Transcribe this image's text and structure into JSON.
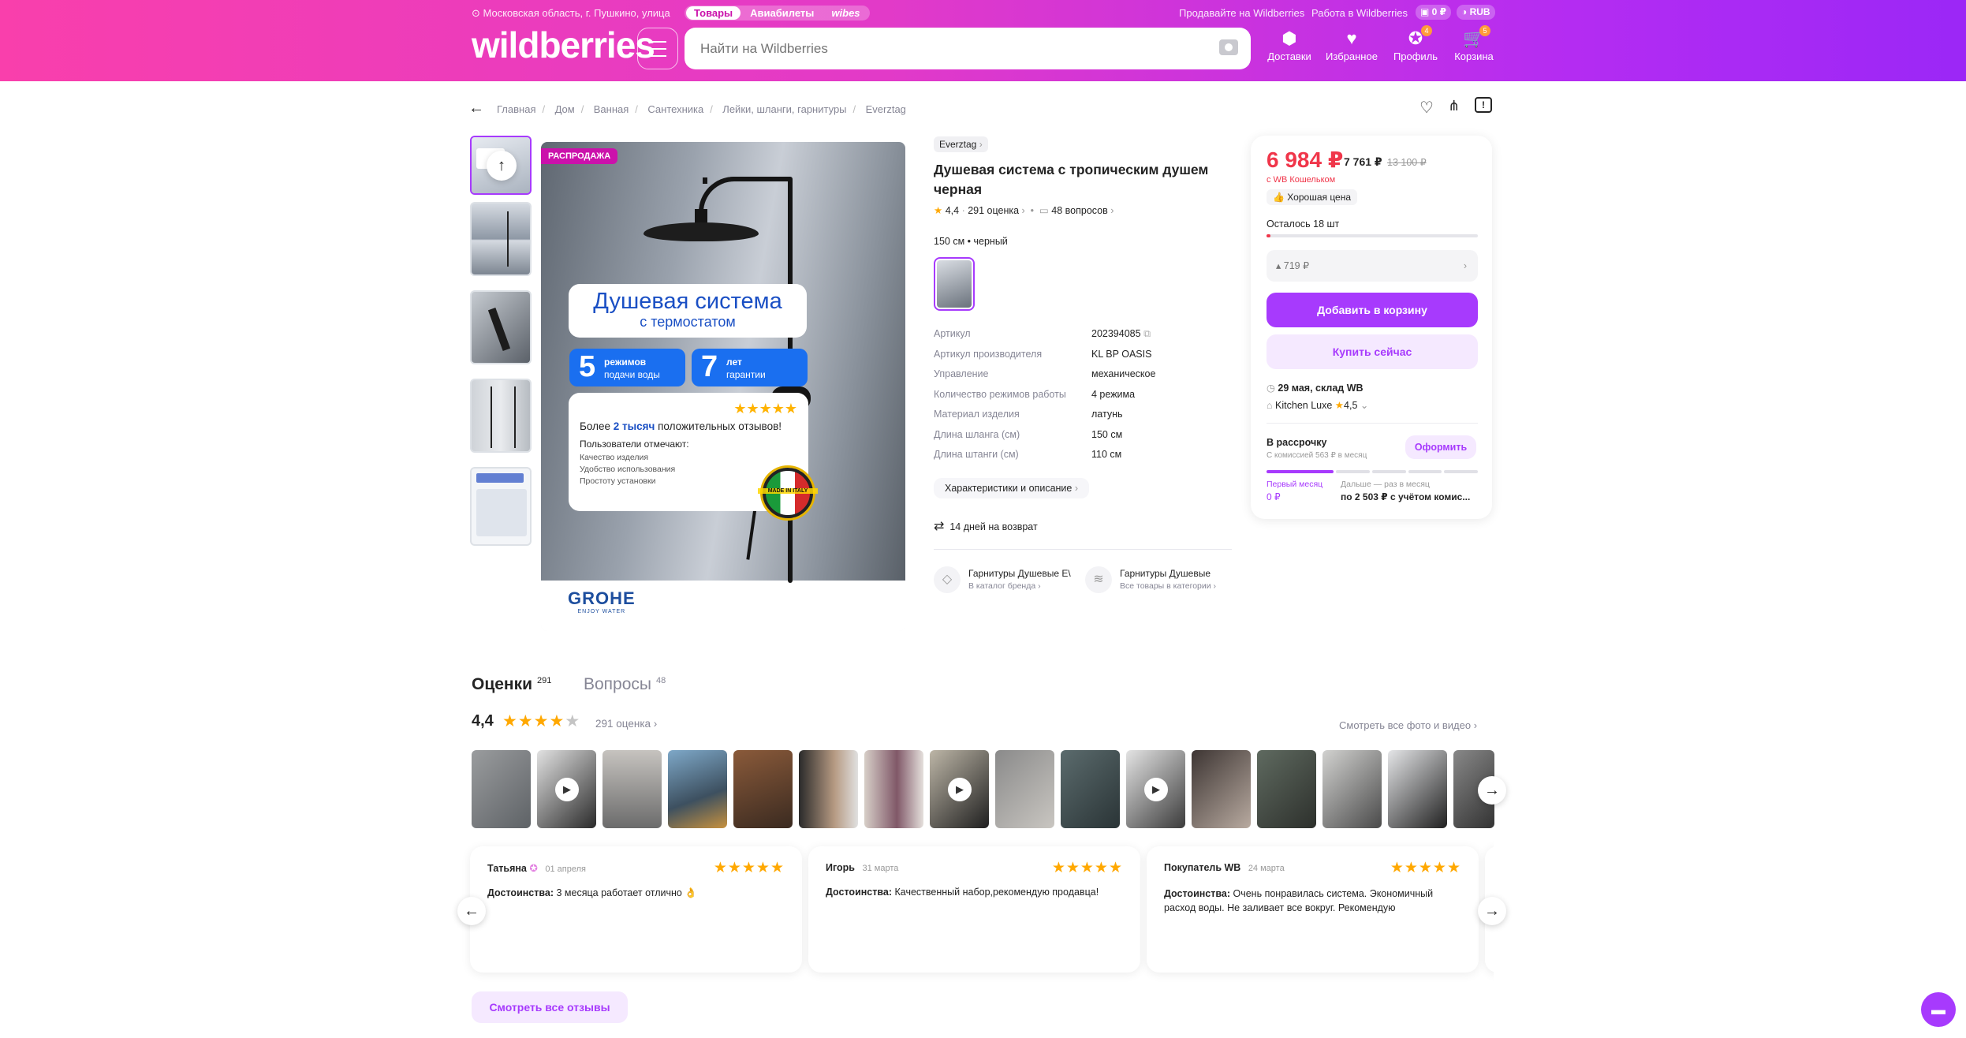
{
  "header": {
    "location": "Московская область, г. Пушкино, улица",
    "tabs": [
      "Товары",
      "Авиабилеты",
      "wibes"
    ],
    "links": [
      "Продавайте на Wildberries",
      "Работа в Wildberries"
    ],
    "balance": "0 ₽",
    "currency": "RUB",
    "logo": "wildberries",
    "search_placeholder": "Найти на Wildberries",
    "nav": [
      {
        "label": "Доставки",
        "icon": "box-icon",
        "badge": ""
      },
      {
        "label": "Избранное",
        "icon": "heart-icon",
        "badge": ""
      },
      {
        "label": "Профиль",
        "icon": "profile-icon",
        "badge": "4"
      },
      {
        "label": "Корзина",
        "icon": "cart-icon",
        "badge": "5"
      }
    ]
  },
  "breadcrumbs": [
    "Главная",
    "Дом",
    "Ванная",
    "Сантехника",
    "Лейки, шланги, гарнитуры",
    "Everztag"
  ],
  "product": {
    "brand": "Everztag",
    "title_line1": "Душевая система с тропическим душем",
    "title_line2": "черная",
    "rating": "4,4",
    "reviews_count": "291 оценка",
    "questions_count": "48 вопросов",
    "variant": "150 см • черный",
    "specs": [
      {
        "k": "Артикул",
        "v": "202394085"
      },
      {
        "k": "Артикул производителя",
        "v": "KL BP OASIS"
      },
      {
        "k": "Управление",
        "v": "механическое"
      },
      {
        "k": "Количество режимов работы",
        "v": "4 режима"
      },
      {
        "k": "Материал изделия",
        "v": "латунь"
      },
      {
        "k": "Длина шланга (см)",
        "v": "150 см"
      },
      {
        "k": "Длина штанги (см)",
        "v": "110 см"
      }
    ],
    "specs_button": "Характеристики и описание",
    "return_text": "14 дней на возврат",
    "brand_card": {
      "title": "Гарнитуры Душевые E\\",
      "sub": "В каталог бренда"
    },
    "category_card": {
      "title": "Гарнитуры Душевые",
      "sub": "Все товары в категории"
    }
  },
  "image": {
    "sale_badge": "РАСПРОДАЖА",
    "headline": "Душевая система",
    "subheadline": "с термостатом",
    "modes_num": "5",
    "modes_text1": "режимов",
    "modes_text2": "подачи воды",
    "warranty_num": "7",
    "warranty_text1": "лет",
    "warranty_text2": "гарантии",
    "review_pre": "Более",
    "review_bold": "2 тысяч",
    "review_post": "положительных отзывов!",
    "users_note": "Пользователи отмечают:",
    "bullets": [
      "Качество изделия",
      "Удобство использования",
      "Простоту установки"
    ],
    "seal": "MADE IN ITALY",
    "grohe": "GROHE",
    "grohe_sub": "ENJOY WATER"
  },
  "price": {
    "wallet_price": "6 984 ₽",
    "price": "7 761 ₽",
    "old_price": "13 100 ₽",
    "wallet_label": "с WB Кошельком",
    "good_price": "Хорошая цена",
    "stock": "Осталось 18 шт",
    "stock_fraction": 0.02,
    "installment_select": "719 ₽",
    "add_to_cart": "Добавить в корзину",
    "buy_now": "Купить сейчас",
    "delivery": "29 мая, склад WB",
    "seller": "Kitchen Luxe",
    "seller_rating": "4,5",
    "installment_title": "В рассрочку",
    "installment_note": "С комиссией 563 ₽ в месяц",
    "installment_button": "Оформить",
    "first_month_label": "Первый месяц",
    "first_month_value": "0 ₽",
    "later_label": "Дальше — раз в месяц",
    "later_value": "по 2 503 ₽ с учётом комис..."
  },
  "reviews": {
    "tab_reviews": "Оценки",
    "tab_reviews_count": "291",
    "tab_questions": "Вопросы",
    "tab_questions_count": "48",
    "rating": "4,4",
    "count": "291 оценка",
    "all_photos": "Смотреть все фото и видео",
    "show_all": "Смотреть все отзывы",
    "items": [
      {
        "author": "Татьяна",
        "date": "01 апреля",
        "label": "Достоинства:",
        "text": "3 месяца работает отлично 👌"
      },
      {
        "author": "Игорь",
        "date": "31 марта",
        "label": "Достоинства:",
        "text": "Качественный набор,рекомендую продавца!"
      },
      {
        "author": "Покупатель WB",
        "date": "24 марта",
        "label": "Достоинства:",
        "text": "Очень понравилась система. Экономичный расход воды. Не заливает все вокруг. Рекомендую"
      }
    ]
  },
  "colors": {
    "accent": "#a73afd",
    "price_red": "#f0364a",
    "star": "#ffa800"
  }
}
